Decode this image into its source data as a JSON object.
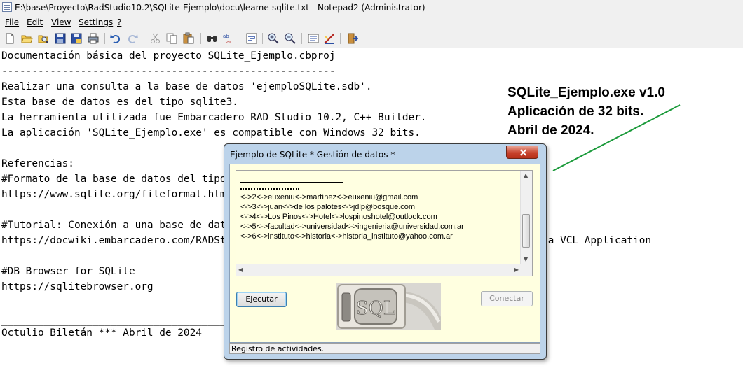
{
  "window": {
    "title": "E:\\base\\Proyecto\\RadStudio10.2\\SQLite-Ejemplo\\docu\\leame-sqlite.txt - Notepad2 (Administrator)"
  },
  "menu": [
    "File",
    "Edit",
    "View",
    "Settings",
    "?"
  ],
  "toolbar_icons": [
    "new-icon",
    "open-icon",
    "browse-icon",
    "save-icon",
    "save-as-icon",
    "print-icon",
    "undo-icon",
    "redo-icon",
    "cut-icon",
    "copy-icon",
    "paste-icon",
    "find-icon",
    "replace-icon",
    "word-wrap-icon",
    "zoom-in-icon",
    "zoom-out-icon",
    "scheme-icon",
    "customize-icon",
    "exit-icon"
  ],
  "editor": {
    "lines": [
      "Documentación básica del proyecto SQLite_Ejemplo.cbproj",
      "-------------------------------------------------------",
      "Realizar una consulta a la base de datos 'ejemploSQLite.sdb'.",
      "Esta base de datos es del tipo sqlite3.",
      "La herramienta utilizada fue Embarcadero RAD Studio 10.2, C++ Builder.",
      "La aplicación 'SQLite_Ejemplo.exe' es compatible con Windows 32 bits.",
      "",
      "Referencias:",
      "#Formato de la base de datos del tipo sqlite3",
      "https://www.sqlite.org/fileformat.html",
      "",
      "#Tutorial: Conexión a una base de datos SQLite desde una aplicación VCL",
      "https://docwiki.embarcadero.com/RADStudio/Sydney/en/Connecting_to_an_SQLite_database_from_a_VCL_Application",
      "",
      "#DB Browser for SQLite",
      "https://sqlitebrowser.org",
      "",
      "",
      "_______________________________________________________",
      "Octulio Biletán *** Abril de 2024"
    ]
  },
  "annotation": {
    "lines": [
      "SQLite_Ejemplo.exe v1.0",
      "Aplicación de 32 bits.",
      "Abril de 2024."
    ],
    "color": "#1a9a3a"
  },
  "dialog": {
    "title": "Ejemplo de SQLite * Gestión de datos *",
    "records": [
      "<->2<->euxeniu<->martínez<->euxeniu@gmail.com",
      "<->3<->juan<->de los palotes<->jdlp@bosque.com",
      "<->4<->Los Pinos<->Hotel<->lospinoshotel@outlook.com",
      "<->5<->facultad<->universidad<->ingenieria@universidad.com.ar",
      "<->6<->instituto<->historia<->historia_instituto@yahoo.com.ar"
    ],
    "execute_label": "Ejecutar",
    "connect_label": "Conectar",
    "image_text": "SQL",
    "status": "Registro de actividades."
  }
}
